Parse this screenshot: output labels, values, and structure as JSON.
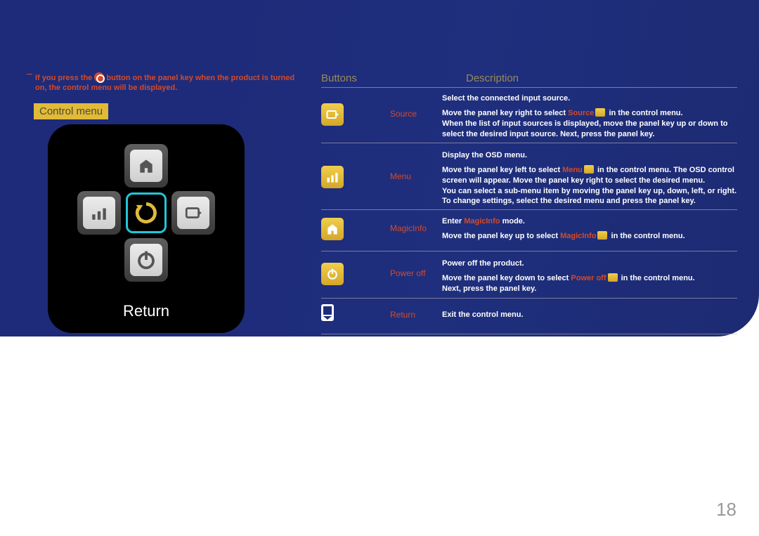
{
  "note": {
    "t1": "If you press the",
    "t2": "button on the panel key when the product is turned on, the control menu will be displayed."
  },
  "controlMenuLabel": "Control menu",
  "deviceLabel": "Return",
  "headers": {
    "buttons": "Buttons",
    "description": "Description"
  },
  "rows": {
    "source": {
      "name": "Source",
      "d1": "Select the connected input source.",
      "d2a": "Move the panel key right to select ",
      "d2b": "Source",
      "d2c": " in the control menu.",
      "d3": "When the list of input sources is displayed, move the panel key up or down to select the desired input source. Next, press the panel key."
    },
    "menu": {
      "name": "Menu",
      "d1": "Display the OSD menu.",
      "d2a": "Move the panel key left to select ",
      "d2b": "Menu",
      "d2c": " in the control menu. The OSD control screen will appear. Move the panel key right to select the desired menu.",
      "d3": "You can select a sub-menu item by moving the panel key up, down, left, or right.",
      "d4": "To change settings, select the desired menu and press the panel key."
    },
    "magicinfo": {
      "name": "MagicInfo",
      "d1a": "Enter ",
      "d1b": "MagicInfo",
      "d1c": " mode.",
      "d2a": "Move the panel key up to select ",
      "d2b": "MagicInfo",
      "d2c": " in the control menu."
    },
    "poweroff": {
      "name": "Power off",
      "d1": "Power off the product.",
      "d2a": "Move the panel key down to select ",
      "d2b": "Power off",
      "d2c": " in the control menu.",
      "d3": "Next, press the panel key."
    },
    "return": {
      "name": "Return",
      "d1": "Exit the control menu."
    }
  },
  "pageNumber": "18"
}
